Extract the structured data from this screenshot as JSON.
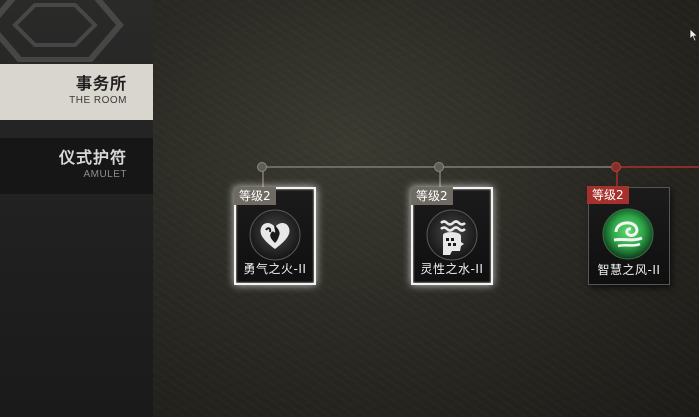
{
  "sidebar": {
    "items": [
      {
        "label_cn": "事务所",
        "label_en": "THE ROOM",
        "active": true
      },
      {
        "label_cn": "仪式护符",
        "label_en": "AMULET",
        "active": false
      }
    ]
  },
  "amulets": [
    {
      "level": "等级2",
      "name": "勇气之火-II",
      "icon": "heart-flame-icon",
      "state": "selected"
    },
    {
      "level": "等级2",
      "name": "灵性之水-II",
      "icon": "water-head-icon",
      "state": "selected"
    },
    {
      "level": "等级2",
      "name": "智慧之风-II",
      "icon": "wind-swirl-icon",
      "state": "active"
    }
  ],
  "colors": {
    "active_nav_bg": "#d9d5cf",
    "accent_red": "#a5312c",
    "wire_gray": "#6b6a64",
    "wind_green": "#2fa84a"
  }
}
